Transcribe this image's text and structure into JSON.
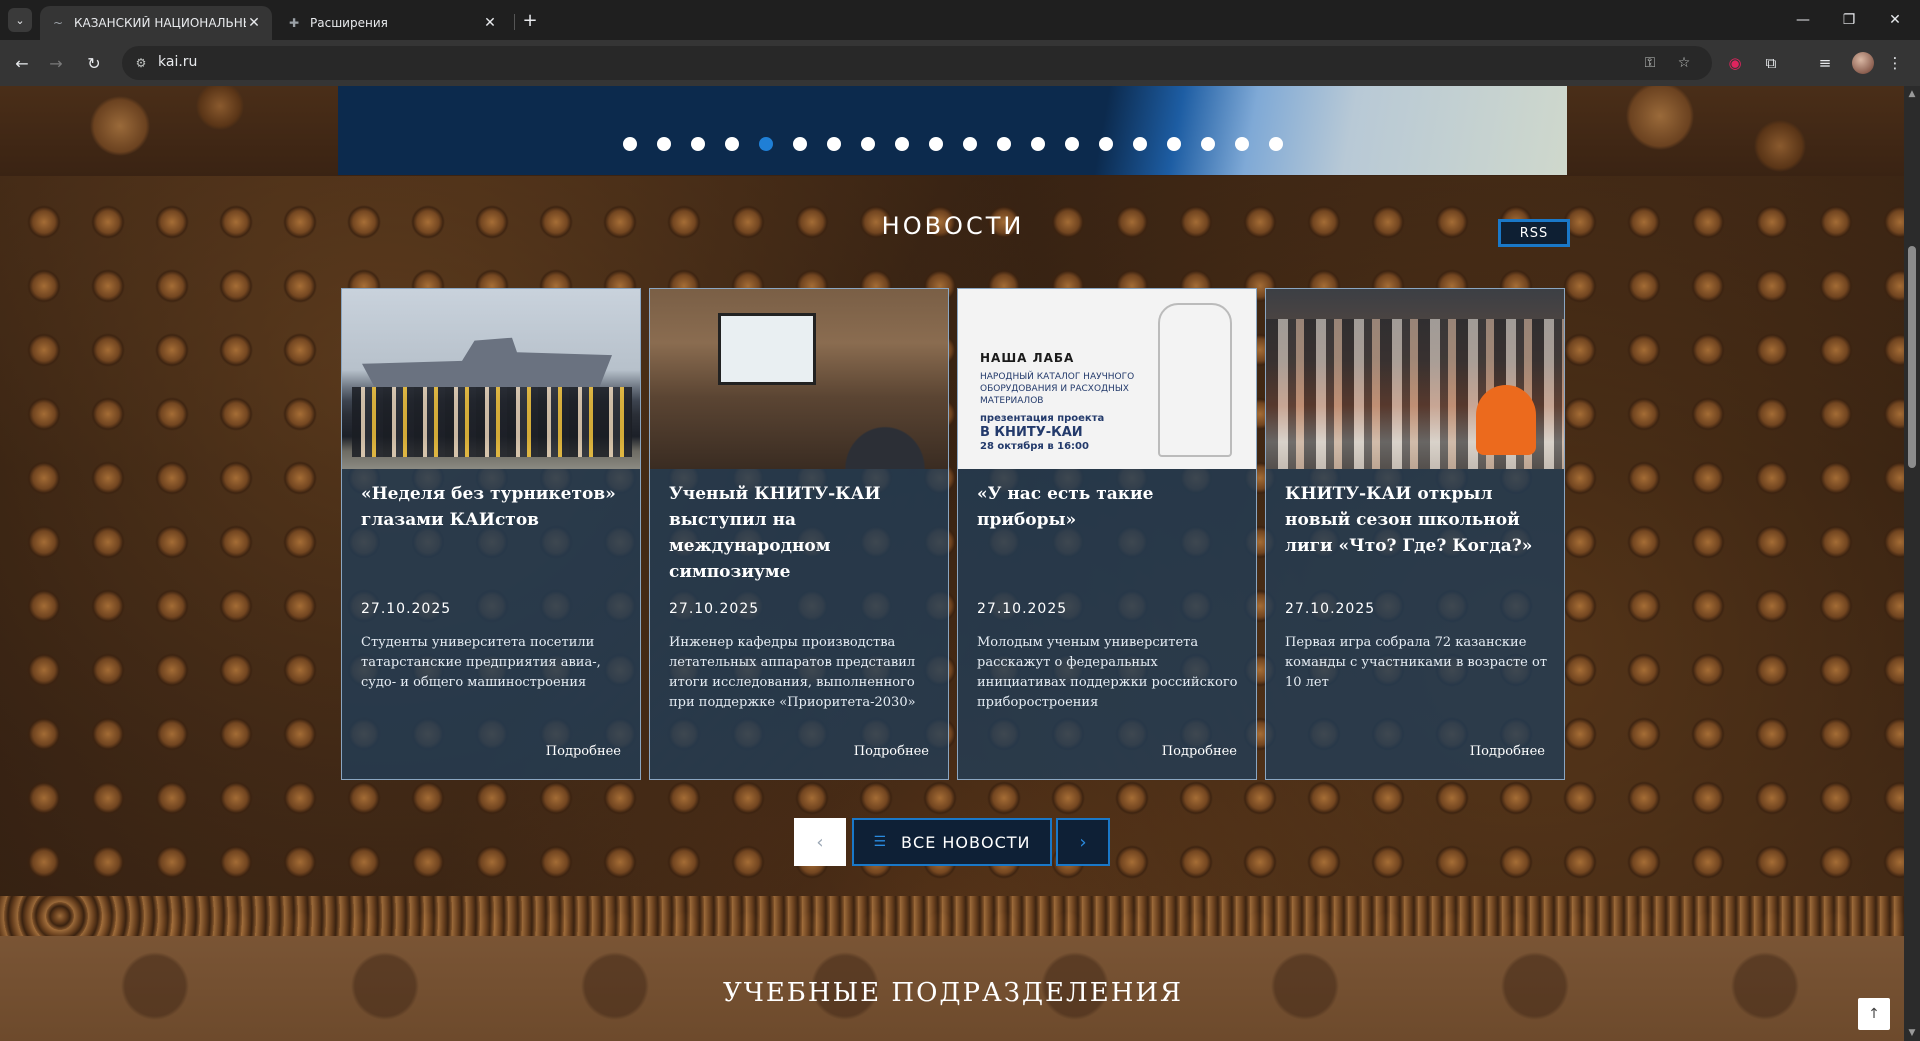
{
  "browser": {
    "tabs": [
      {
        "title": "КАЗАНСКИЙ НАЦИОНАЛЬНЫЙ",
        "close": "✕",
        "icon": "kai-logo-icon"
      },
      {
        "title": "Расширения",
        "close": "✕",
        "icon": "puzzle-icon"
      }
    ],
    "new_tab": "+",
    "url": "kai.ru",
    "window": {
      "minimize": "—",
      "restore": "❐",
      "close": "✕"
    }
  },
  "slider": {
    "dot_count": 20,
    "active_dot": 5
  },
  "news": {
    "title": "НОВОСТИ",
    "rss": "RSS",
    "cards": [
      {
        "headline": "«Неделя без турникетов» глазами КАИстов",
        "date": "27.10.2025",
        "description": "Студенты университета посетили татарстанские предприятия авиа-, судо- и общего машиностроения",
        "more": "Подробнее"
      },
      {
        "headline": "Ученый КНИТУ-КАИ выступил на международном симпозиуме",
        "date": "27.10.2025",
        "description": "Инженер кафедры производства летательных аппаратов представил итоги исследования, выполненного при поддержке «Приоритета-2030»",
        "more": "Подробнее"
      },
      {
        "headline": "«У нас есть такие приборы»",
        "date": "27.10.2025",
        "description": "Молодым ученым университета расскажут о федеральных инициативах поддержки российского приборостроения",
        "more": "Подробнее",
        "image_text": {
          "title": "НАША ЛАБА",
          "subtitle": "НАРОДНЫЙ КАТАЛОГ НАУЧНОГО ОБОРУДОВАНИЯ И РАСХОДНЫХ МАТЕРИАЛОВ",
          "line1": "презентация проекта",
          "line2": "В КНИТУ-КАИ",
          "line3": "28 октября в 16:00"
        }
      },
      {
        "headline": "КНИТУ-КАИ открыл новый сезон школьной лиги «Что? Где? Когда?»",
        "date": "27.10.2025",
        "description": "Первая игра собрала 72 казанские команды с участниками в возрасте от 10 лет",
        "more": "Подробнее"
      }
    ],
    "all_news": "ВСЕ НОВОСТИ",
    "prev": "‹",
    "next": "›"
  },
  "divisions": {
    "title": "УЧЕБНЫЕ ПОДРАЗДЕЛЕНИЯ"
  },
  "scroll_top": "↑"
}
